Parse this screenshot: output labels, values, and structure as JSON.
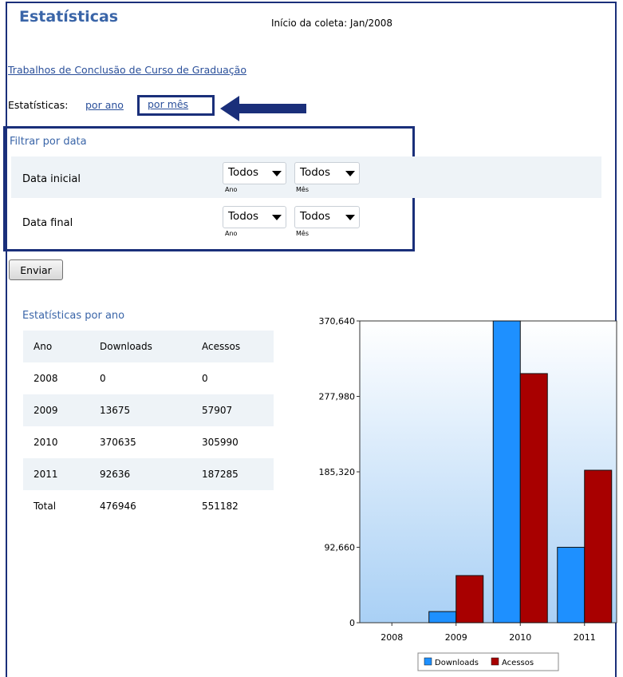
{
  "page": {
    "title": "Estatísticas",
    "coleta": "Início da coleta: Jan/2008",
    "tcc_link": "Trabalhos de Conclusão de Curso de Graduação",
    "stats_label": "Estatísticas:",
    "por_ano": "por ano",
    "por_mes": "por mês"
  },
  "filter": {
    "title": "Filtrar por data",
    "rows": [
      {
        "label": "Data inicial",
        "year": "Todos",
        "month": "Todos"
      },
      {
        "label": "Data final",
        "year": "Todos",
        "month": "Todos"
      }
    ],
    "year_caption": "Ano",
    "month_caption": "Mês",
    "submit": "Enviar"
  },
  "table": {
    "title": "Estatísticas por ano",
    "headers": [
      "Ano",
      "Downloads",
      "Acessos"
    ],
    "rows": [
      [
        "2008",
        "0",
        "0"
      ],
      [
        "2009",
        "13675",
        "57907"
      ],
      [
        "2010",
        "370635",
        "305990"
      ],
      [
        "2011",
        "92636",
        "187285"
      ],
      [
        "Total",
        "476946",
        "551182"
      ]
    ]
  },
  "chart_data": {
    "type": "bar",
    "categories": [
      "2008",
      "2009",
      "2010",
      "2011"
    ],
    "series": [
      {
        "name": "Downloads",
        "color": "#1e90ff",
        "values": [
          0,
          13675,
          370635,
          92636
        ]
      },
      {
        "name": "Acessos",
        "color": "#a80000",
        "values": [
          0,
          57907,
          305990,
          187285
        ]
      }
    ],
    "yticks": [
      "0",
      "92,660",
      "185,320",
      "277,980",
      "370,640"
    ],
    "ylim": [
      0,
      370640
    ],
    "legend_position": "bottom-center",
    "grid": false
  },
  "colors": {
    "accent": "#3a65a8",
    "frame": "#1a2f7a",
    "link": "#2a4f9a"
  },
  "icons": {
    "arrow": "left-arrow-icon",
    "select": "chevron-down-icon"
  }
}
